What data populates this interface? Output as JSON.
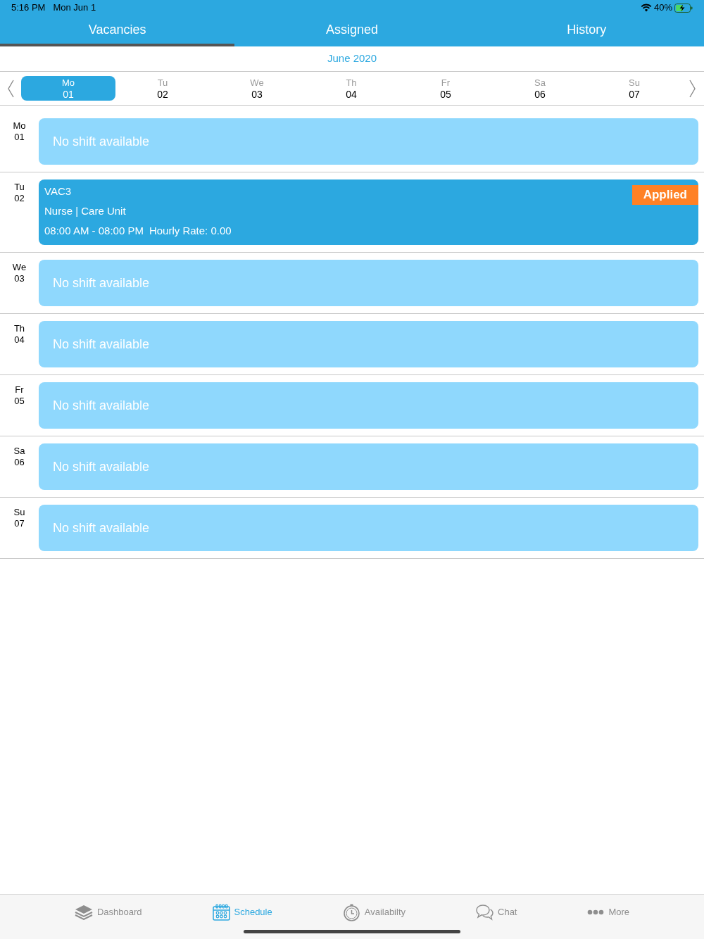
{
  "status_bar": {
    "time": "5:16 PM",
    "date": "Mon Jun 1",
    "battery": "40%"
  },
  "tabs": [
    {
      "label": "Vacancies",
      "selected": true
    },
    {
      "label": "Assigned",
      "selected": false
    },
    {
      "label": "History",
      "selected": false
    }
  ],
  "month": "June 2020",
  "week": [
    {
      "weekday": "Mo",
      "day": "01",
      "selected": true
    },
    {
      "weekday": "Tu",
      "day": "02",
      "selected": false
    },
    {
      "weekday": "We",
      "day": "03",
      "selected": false
    },
    {
      "weekday": "Th",
      "day": "04",
      "selected": false
    },
    {
      "weekday": "Fr",
      "day": "05",
      "selected": false
    },
    {
      "weekday": "Sa",
      "day": "06",
      "selected": false
    },
    {
      "weekday": "Su",
      "day": "07",
      "selected": false
    }
  ],
  "days": [
    {
      "weekday": "Mo",
      "day": "01",
      "kind": "empty",
      "message": "No shift available"
    },
    {
      "weekday": "Tu",
      "day": "02",
      "kind": "shift",
      "code": "VAC3",
      "role": "Nurse | Care Unit",
      "time": "08:00 AM - 08:00 PM",
      "rate": "Hourly Rate: 0.00",
      "status": "Applied"
    },
    {
      "weekday": "We",
      "day": "03",
      "kind": "empty",
      "message": "No shift available"
    },
    {
      "weekday": "Th",
      "day": "04",
      "kind": "empty",
      "message": "No shift available"
    },
    {
      "weekday": "Fr",
      "day": "05",
      "kind": "empty",
      "message": "No shift available"
    },
    {
      "weekday": "Sa",
      "day": "06",
      "kind": "empty",
      "message": "No shift available"
    },
    {
      "weekday": "Su",
      "day": "07",
      "kind": "empty",
      "message": "No shift available"
    }
  ],
  "bottom_nav": [
    {
      "label": "Dashboard",
      "selected": false
    },
    {
      "label": "Schedule",
      "selected": true
    },
    {
      "label": "Availabilty",
      "selected": false
    },
    {
      "label": "Chat",
      "selected": false
    },
    {
      "label": "More",
      "selected": false
    }
  ]
}
